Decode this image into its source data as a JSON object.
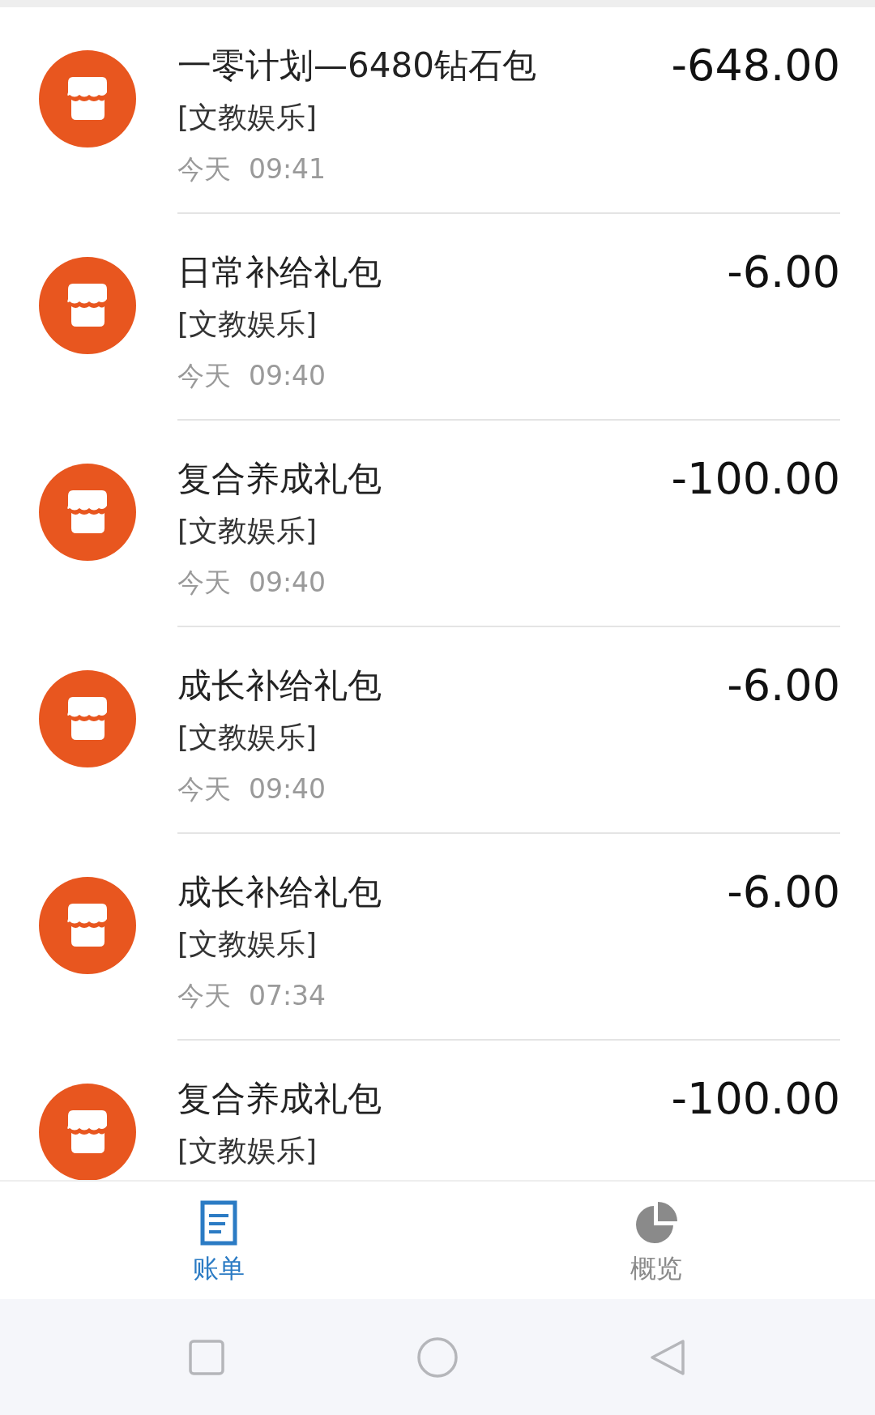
{
  "transactions": [
    {
      "title": "一零计划—6480钻石包",
      "category": "[文教娱乐]",
      "day": "今天",
      "time": "09:41",
      "amount": "-648.00"
    },
    {
      "title": "日常补给礼包",
      "category": "[文教娱乐]",
      "day": "今天",
      "time": "09:40",
      "amount": "-6.00"
    },
    {
      "title": "复合养成礼包",
      "category": "[文教娱乐]",
      "day": "今天",
      "time": "09:40",
      "amount": "-100.00"
    },
    {
      "title": "成长补给礼包",
      "category": "[文教娱乐]",
      "day": "今天",
      "time": "09:40",
      "amount": "-6.00"
    },
    {
      "title": "成长补给礼包",
      "category": "[文教娱乐]",
      "day": "今天",
      "time": "07:34",
      "amount": "-6.00"
    },
    {
      "title": "复合养成礼包",
      "category": "[文教娱乐]",
      "amount": "-100.00"
    }
  ],
  "tabs": [
    {
      "label": "账单",
      "kind": "bill",
      "selected": true
    },
    {
      "label": "概览",
      "kind": "overview",
      "selected": false
    }
  ]
}
